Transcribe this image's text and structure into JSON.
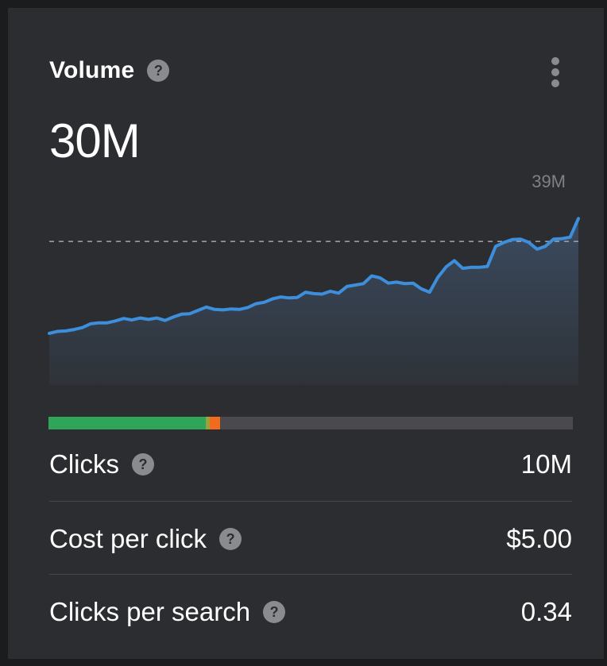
{
  "card": {
    "title": "Volume",
    "help_glyph": "?",
    "menu_icon": "more-vertical-icon",
    "value": "30M",
    "max_label": "39M"
  },
  "chart_data": {
    "type": "area",
    "max_label": "39M",
    "reference_value": 30,
    "ylim": [
      0,
      39
    ],
    "line_color": "#3d8fdb",
    "fill_color": "#3d5068",
    "values": [
      10.8,
      11.2,
      11.3,
      11.6,
      12.0,
      12.8,
      13.0,
      13.0,
      13.4,
      13.9,
      13.6,
      14.0,
      13.7,
      14.0,
      13.5,
      14.2,
      14.8,
      14.9,
      15.6,
      16.3,
      15.8,
      15.7,
      15.9,
      15.8,
      16.2,
      17.0,
      17.3,
      18.0,
      18.4,
      18.2,
      18.3,
      19.4,
      19.1,
      19.0,
      19.6,
      19.2,
      20.6,
      20.9,
      21.2,
      22.8,
      22.4,
      21.3,
      21.5,
      21.2,
      21.3,
      20.1,
      19.4,
      22.5,
      24.7,
      26.0,
      24.4,
      24.6,
      24.6,
      24.8,
      29.0,
      29.8,
      30.4,
      30.5,
      29.8,
      28.4,
      29.0,
      30.5,
      30.6,
      30.9,
      34.8
    ]
  },
  "progress": {
    "segments": [
      {
        "name": "green",
        "fraction": 0.3,
        "color": "#2fa55a"
      },
      {
        "name": "amber",
        "fraction": 0.008,
        "color": "#9aa23a"
      },
      {
        "name": "orange",
        "fraction": 0.02,
        "color": "#f26a1b"
      }
    ],
    "track_color": "#4a4a4e"
  },
  "metrics": [
    {
      "label": "Clicks",
      "value": "10M"
    },
    {
      "label": "Cost per click",
      "value": "$5.00"
    },
    {
      "label": "Clicks per search",
      "value": "0.34"
    }
  ],
  "colors": {
    "background": "#2c2d30",
    "text": "#ffffff",
    "muted": "#8a8b8e"
  }
}
